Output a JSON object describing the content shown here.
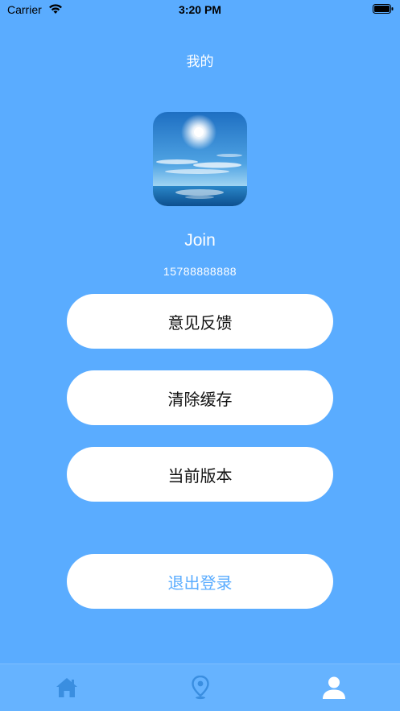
{
  "status_bar": {
    "carrier": "Carrier",
    "time": "3:20 PM"
  },
  "nav": {
    "title": "我的"
  },
  "profile": {
    "name": "Join",
    "phone": "15788888888"
  },
  "menu": {
    "feedback": "意见反馈",
    "clear_cache": "清除缓存",
    "version": "当前版本",
    "logout": "退出登录"
  },
  "tabs": [
    {
      "icon": "home-icon",
      "active": false
    },
    {
      "icon": "location-pin-icon",
      "active": false
    },
    {
      "icon": "person-icon",
      "active": true
    }
  ],
  "colors": {
    "background": "#5AACFF",
    "tab_bar": "#66B3FF",
    "tab_inactive": "#3A8EE0",
    "tab_active": "#FFFFFF",
    "logout_text": "#5AACFF"
  }
}
